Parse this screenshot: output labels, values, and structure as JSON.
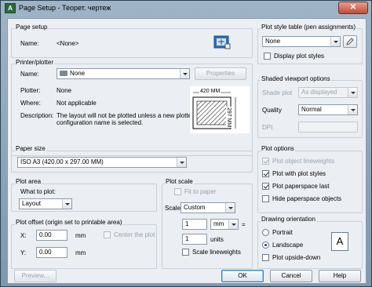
{
  "window": {
    "title": "Page Setup - Теорет. чертеж",
    "close_label": "✕"
  },
  "page_setup": {
    "group_title": "Page setup",
    "name_label": "Name:",
    "name_value": "<None>"
  },
  "printer": {
    "group_title": "Printer/plotter",
    "name_label": "Name:",
    "name_value": "None",
    "properties_button": "Properties",
    "plotter_label": "Plotter:",
    "plotter_value": "None",
    "where_label": "Where:",
    "where_value": "Not applicable",
    "description_label": "Description:",
    "description_line1": "The layout will not be plotted unless a new plotter",
    "description_line2": "configuration name is selected.",
    "preview_width": "420 MM",
    "preview_height": "297 MM"
  },
  "paper_size": {
    "group_title": "Paper size",
    "value": "ISO A3 (420.00 x 297.00 MM)"
  },
  "plot_area": {
    "group_title": "Plot area",
    "what_label": "What to plot:",
    "what_value": "Layout"
  },
  "plot_offset": {
    "group_title": "Plot offset (origin set to printable area)",
    "x_label": "X:",
    "x_value": "0.00",
    "x_unit": "mm",
    "y_label": "Y:",
    "y_value": "0.00",
    "y_unit": "mm",
    "center_label": "Center the plot"
  },
  "plot_scale": {
    "group_title": "Plot scale",
    "fit_label": "Fit to paper",
    "scale_label": "Scale:",
    "scale_value": "Custom",
    "value1": "1",
    "unit1": "mm",
    "equals": "=",
    "value2": "1",
    "unit2": "units",
    "lineweights_label": "Scale lineweights"
  },
  "plot_style_table": {
    "group_title": "Plot style table (pen assignments)",
    "value": "None",
    "display_label": "Display plot styles"
  },
  "shaded_viewport": {
    "group_title": "Shaded viewport options",
    "shade_label": "Shade plot",
    "shade_value": "As displayed",
    "quality_label": "Quality",
    "quality_value": "Normal",
    "dpi_label": "DPI",
    "dpi_value": ""
  },
  "plot_options": {
    "group_title": "Plot options",
    "items": [
      {
        "label": "Plot object lineweights",
        "checked": true,
        "disabled": true
      },
      {
        "label": "Plot with plot styles",
        "checked": true,
        "disabled": false
      },
      {
        "label": "Plot paperspace last",
        "checked": true,
        "disabled": false
      },
      {
        "label": "Hide paperspace objects",
        "checked": false,
        "disabled": false
      }
    ]
  },
  "orientation": {
    "group_title": "Drawing orientation",
    "portrait": "Portrait",
    "landscape": "Landscape",
    "upside_down": "Plot upside-down",
    "selected": "landscape",
    "glyph": "A"
  },
  "footer": {
    "preview": "Preview...",
    "ok": "OK",
    "cancel": "Cancel",
    "help": "Help"
  }
}
